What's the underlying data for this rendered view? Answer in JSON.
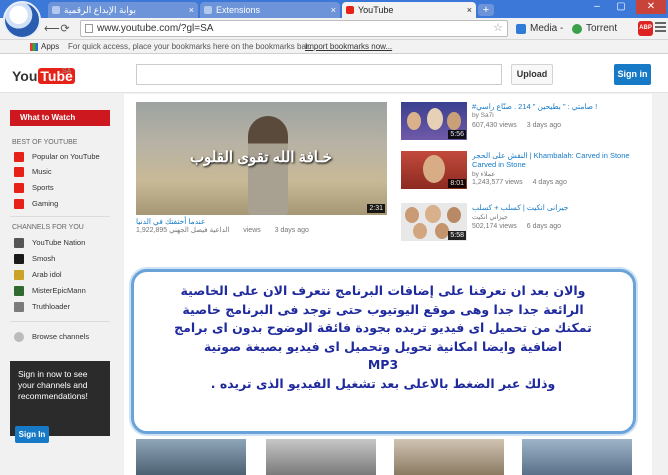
{
  "browser": {
    "tabs": [
      {
        "label": "بوابة الإبداع الرقمية"
      },
      {
        "label": "Extensions"
      },
      {
        "label": "YouTube"
      }
    ],
    "window_buttons": {
      "minimize": "–",
      "maximize": "▢",
      "close": "✕"
    },
    "url": "www.youtube.com/?gl=SA",
    "extensions": {
      "media": "Media -",
      "torrent": "Torrent",
      "abp": "ABP"
    },
    "bookmarks": {
      "apps": "Apps",
      "hint": "For quick access, place your bookmarks here on the bookmarks bar.",
      "import_link": "Import bookmarks now..."
    },
    "icons": [
      "back-icon",
      "forward-icon",
      "reload-icon",
      "home-icon",
      "star-icon",
      "menu-icon"
    ]
  },
  "youtube": {
    "logo": {
      "you": "You",
      "tube": "Tube",
      "country": "SA"
    },
    "search": {
      "placeholder": ""
    },
    "upload_label": "Upload",
    "signin_label": "Sign in",
    "guide": {
      "what_to_watch": "What to Watch",
      "best_header": "BEST OF YOUTUBE",
      "best_items": [
        "Popular on YouTube",
        "Music",
        "Sports",
        "Gaming"
      ],
      "channels_header": "CHANNELS FOR YOU",
      "channel_items": [
        "YouTube Nation",
        "Smosh",
        "Arab idol",
        "MisterEpicMann",
        "Truthloader"
      ],
      "browse_channels": "Browse channels",
      "promo_text": "Sign in now to see your channels and recommendations!",
      "promo_button": "Sign In"
    },
    "featured": {
      "overlay_caption": "خـافة الله تقوى القلوب",
      "duration": "2:31",
      "title": "عندما أختفتك في الدنيا",
      "channel": "الداعية فيصل الجهني",
      "views": "1,922,895",
      "views_label": "views",
      "age": "3 days ago"
    },
    "side_videos": [
      {
        "title": "! صامتي : \" بطيحين \" 214 . صنّاع راسي#",
        "channel": "by Sa7i",
        "views": "607,430 views",
        "age": "3 days ago",
        "duration": "5:56"
      },
      {
        "title": "النقش على الحجر | Khambalah: Carved in Stone",
        "title2": "Carved in Stone",
        "channel": "by عملاء",
        "views": "1,243,577 views",
        "age": "4 days ago",
        "duration": "8:01"
      },
      {
        "title": "جيزانى انكيت | كسلب + كسلب",
        "channel": "جيزاني انكيت",
        "views": "502,174 views",
        "age": "6 days ago",
        "duration": "5:58"
      }
    ],
    "overlay_lines": [
      "والان بعد ان تعرفنا على إضافات البرنامج نتعرف الان على الخاصية",
      "الرائعة جدا جدا وهى موقع اليوتيوب حتى توجد فى البرنامج خاصية",
      "تمكنك من تحميل اى فيديو تريده بجودة فائقة الوضوح بدون اى برامج",
      "اضافية وايضا امكانية تحويل وتحميل اى فيديو بصيغة صوتية",
      "MP3",
      "وذلك عبر الضغط بالاعلى بعد تشغيل الفيديو الذى تريده ."
    ]
  },
  "colors": {
    "chrome_blue": "#3c78d8",
    "yt_red": "#e62117",
    "yt_blue": "#167ac6",
    "overlay_text": "#1f2a9c",
    "overlay_border": "#6aa3d9"
  }
}
